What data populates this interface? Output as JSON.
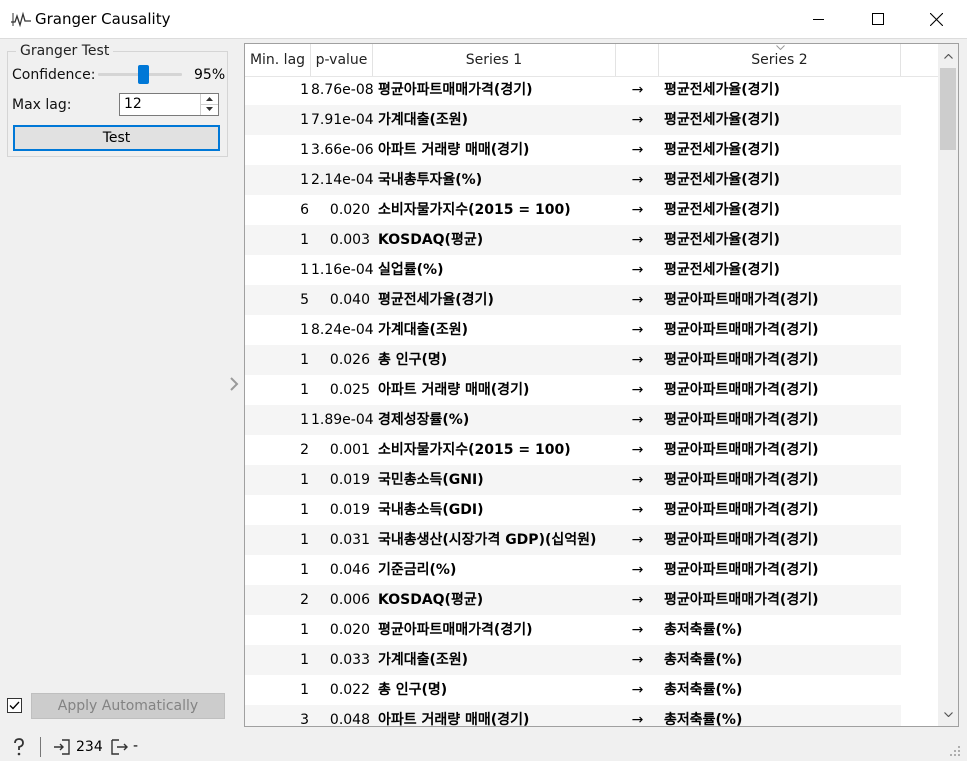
{
  "window": {
    "title": "Granger Causality"
  },
  "controls": {
    "group_title": "Granger Test",
    "confidence_label": "Confidence:",
    "confidence_value": "95%",
    "confidence_level": 0.95,
    "maxlag_label": "Max lag:",
    "maxlag_value": "12",
    "test_label": "Test",
    "apply_label": "Apply Automatically",
    "apply_checked": true
  },
  "status": {
    "input_count": "234",
    "output_text": "-"
  },
  "table": {
    "columns": [
      "Min. lag",
      "p-value",
      "Series 1",
      "",
      "Series 2"
    ],
    "rows": [
      {
        "lag": "1",
        "p": "8.76e-08",
        "s1": "평균아파트매매가격(경기)",
        "arrow": "→",
        "s2": "평균전세가율(경기)"
      },
      {
        "lag": "1",
        "p": "7.91e-04",
        "s1": "가계대출(조원)",
        "arrow": "→",
        "s2": "평균전세가율(경기)"
      },
      {
        "lag": "1",
        "p": "3.66e-06",
        "s1": "아파트 거래량 매매(경기)",
        "arrow": "→",
        "s2": "평균전세가율(경기)"
      },
      {
        "lag": "1",
        "p": "2.14e-04",
        "s1": "국내총투자율(%)",
        "arrow": "→",
        "s2": "평균전세가율(경기)"
      },
      {
        "lag": "6",
        "p": "0.020",
        "s1": "소비자물가지수(2015 = 100)",
        "arrow": "→",
        "s2": "평균전세가율(경기)"
      },
      {
        "lag": "1",
        "p": "0.003",
        "s1": "KOSDAQ(평균)",
        "arrow": "→",
        "s2": "평균전세가율(경기)"
      },
      {
        "lag": "1",
        "p": "1.16e-04",
        "s1": "실업률(%)",
        "arrow": "→",
        "s2": "평균전세가율(경기)"
      },
      {
        "lag": "5",
        "p": "0.040",
        "s1": "평균전세가율(경기)",
        "arrow": "→",
        "s2": "평균아파트매매가격(경기)"
      },
      {
        "lag": "1",
        "p": "8.24e-04",
        "s1": "가계대출(조원)",
        "arrow": "→",
        "s2": "평균아파트매매가격(경기)"
      },
      {
        "lag": "1",
        "p": "0.026",
        "s1": "총 인구(명)",
        "arrow": "→",
        "s2": "평균아파트매매가격(경기)"
      },
      {
        "lag": "1",
        "p": "0.025",
        "s1": "아파트 거래량 매매(경기)",
        "arrow": "→",
        "s2": "평균아파트매매가격(경기)"
      },
      {
        "lag": "1",
        "p": "1.89e-04",
        "s1": "경제성장률(%)",
        "arrow": "→",
        "s2": "평균아파트매매가격(경기)"
      },
      {
        "lag": "2",
        "p": "0.001",
        "s1": "소비자물가지수(2015 = 100)",
        "arrow": "→",
        "s2": "평균아파트매매가격(경기)"
      },
      {
        "lag": "1",
        "p": "0.019",
        "s1": "국민총소득(GNI)",
        "arrow": "→",
        "s2": "평균아파트매매가격(경기)"
      },
      {
        "lag": "1",
        "p": "0.019",
        "s1": "국내총소득(GDI)",
        "arrow": "→",
        "s2": "평균아파트매매가격(경기)"
      },
      {
        "lag": "1",
        "p": "0.031",
        "s1": "국내총생산(시장가격 GDP)(십억원)",
        "arrow": "→",
        "s2": "평균아파트매매가격(경기)"
      },
      {
        "lag": "1",
        "p": "0.046",
        "s1": "기준금리(%)",
        "arrow": "→",
        "s2": "평균아파트매매가격(경기)"
      },
      {
        "lag": "2",
        "p": "0.006",
        "s1": "KOSDAQ(평균)",
        "arrow": "→",
        "s2": "평균아파트매매가격(경기)"
      },
      {
        "lag": "1",
        "p": "0.020",
        "s1": "평균아파트매매가격(경기)",
        "arrow": "→",
        "s2": "총저축률(%)"
      },
      {
        "lag": "1",
        "p": "0.033",
        "s1": "가계대출(조원)",
        "arrow": "→",
        "s2": "총저축률(%)"
      },
      {
        "lag": "1",
        "p": "0.022",
        "s1": "총 인구(명)",
        "arrow": "→",
        "s2": "총저축률(%)"
      },
      {
        "lag": "3",
        "p": "0.048",
        "s1": "아파트 거래량 매매(경기)",
        "arrow": "→",
        "s2": "총저축률(%)"
      }
    ]
  },
  "colors": {
    "accent": "#0078d7",
    "alt_row": "#f5f5f5"
  }
}
